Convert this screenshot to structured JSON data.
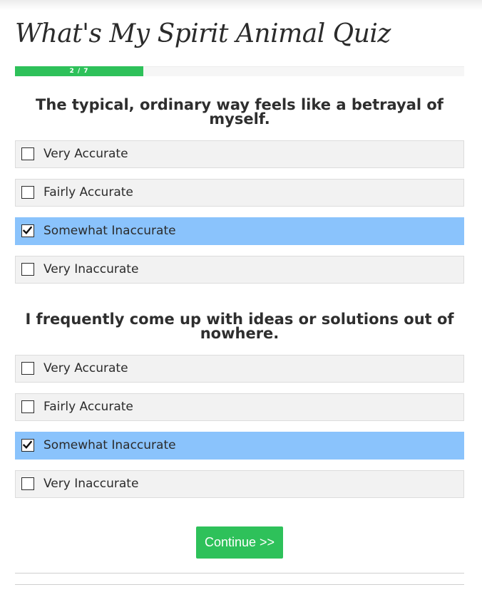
{
  "quiz": {
    "title": "What's My Spirit Animal Quiz",
    "progress": {
      "label": "2 / 7",
      "fraction": 0.2857
    }
  },
  "questions": [
    {
      "text": "The typical, ordinary way feels like a betrayal of myself.",
      "options": [
        {
          "label": "Very Accurate",
          "checked": false
        },
        {
          "label": "Fairly Accurate",
          "checked": false
        },
        {
          "label": "Somewhat Inaccurate",
          "checked": true
        },
        {
          "label": "Very Inaccurate",
          "checked": false
        }
      ]
    },
    {
      "text": "I frequently come up with ideas or solutions out of nowhere.",
      "options": [
        {
          "label": "Very Accurate",
          "checked": false
        },
        {
          "label": "Fairly Accurate",
          "checked": false
        },
        {
          "label": "Somewhat Inaccurate",
          "checked": true
        },
        {
          "label": "Very Inaccurate",
          "checked": false
        }
      ]
    }
  ],
  "continue_label": "Continue >>",
  "colors": {
    "accent_green": "#2ec15a",
    "selected_blue": "#8ac3fc",
    "option_bg": "#f2f2f2"
  },
  "icons": {
    "unchecked": "checkbox-empty-icon",
    "checked": "checkbox-checked-icon"
  }
}
